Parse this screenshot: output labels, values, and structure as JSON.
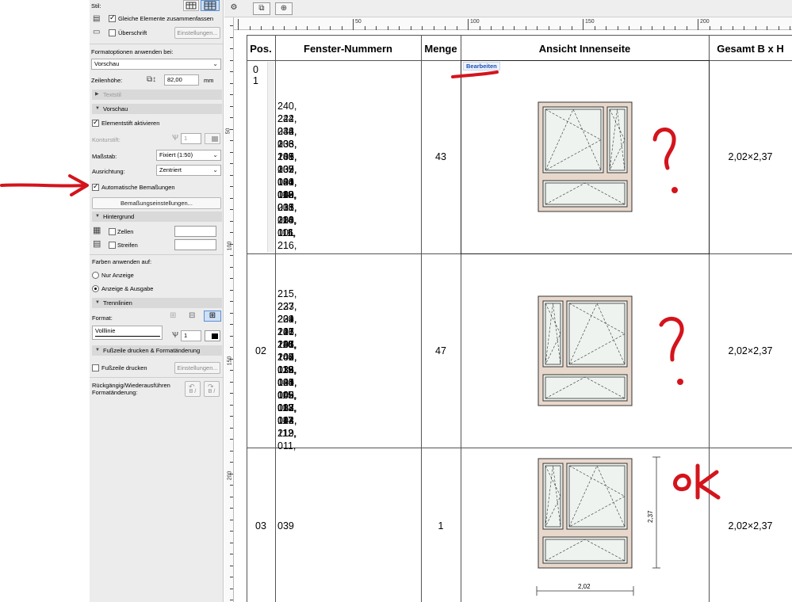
{
  "panel": {
    "stil_label": "Stil:",
    "gleiche_elemente": "Gleiche Elemente zusammenfassen",
    "ueberschrift": "Überschrift",
    "einstellungen": "Einstellungen...",
    "formatoptionen_label": "Formatoptionen anwenden bei:",
    "vorschau_select": "Vorschau",
    "zeilenhoehe_label": "Zeilenhöhe:",
    "zeilenhoehe_value": "82,00",
    "zeilenhoehe_unit": "mm",
    "textstil_section": "Textstil",
    "vorschau_section": "Vorschau",
    "elementstift": "Elementstift aktivieren",
    "konturstift_label": "Konturstift:",
    "konturstift_value": "1",
    "massstab_label": "Maßstab:",
    "massstab_value": "Fixiert (1:50)",
    "ausrichtung_label": "Ausrichtung:",
    "ausrichtung_value": "Zentriert",
    "auto_bemassungen": "Automatische Bemaßungen",
    "bemassungseinstellungen": "Bemaßungseinstellungen...",
    "hintergrund_section": "Hintergrund",
    "zellen": "Zellen",
    "streifen": "Streifen",
    "farben_label": "Farben anwenden auf:",
    "nur_anzeige": "Nur Anzeige",
    "anzeige_ausgabe": "Anzeige & Ausgabe",
    "trennlinien_section": "Trennlinien",
    "format_label": "Format:",
    "linetype": "Volllinie",
    "pen_value": "1",
    "fusszeile_section": "Fußzeile drucken & Formatänderung",
    "fusszeile_drucken": "Fußzeile drucken",
    "einstellungen2": "Einstellungen...",
    "undo_line1": "Rückgängig/Wiederausführen",
    "undo_line2": "Formatänderung:",
    "undo_btn1": "B /",
    "undo_btn2": "B /"
  },
  "rulers": {
    "top": [
      "50",
      "100",
      "150",
      "200"
    ],
    "left": [
      "50",
      "100",
      "150",
      "200"
    ]
  },
  "table": {
    "headers": [
      "Pos.",
      "Fenster-Nummern",
      "Menge",
      "Ansicht Innenseite",
      "Gesamt B x H"
    ],
    "edit_badge": "Bearbeiten",
    "rows": [
      {
        "pos_a": "0",
        "pos_b": "1",
        "nummern": [
          "240, 222, 234, 236, 238,",
          "244, 242, 203, 205, 209,",
          "036, 033, 109, 132, 134,",
          "136, 141, 139, 101, 102,",
          "105, 107, 120, 008, 031,",
          "035, 044, 040, 038, 003,",
          "006, 019, 015, 218, 116,",
          "118, 201, 220, 111, 216,",
          "013, 114, 001"
        ],
        "menge": "43",
        "gesamt": "2,02×2,37"
      },
      {
        "pos": "02",
        "nummern": [
          "215, 223, 221, 217, 235,",
          "237, 239, 243, 241, 202,",
          "204, 206, 208, 207, 016,",
          "121, 110, 108, 133, 135,",
          "137, 140, 138, 103, 106,",
          "104, 119, 020, 009, 007,",
          "032, 041, 042, 037, 002,",
          "004, 005, 018, 014, 219,",
          "115, 012, 143, 112, 011,",
          "113, 117"
        ],
        "menge": "47",
        "gesamt": "2,02×2,37"
      },
      {
        "pos": "03",
        "nummern": [
          "039"
        ],
        "menge": "1",
        "gesamt": "2,02×2,37",
        "dim_v": "2,37",
        "dim_h": "2,02"
      }
    ]
  },
  "annotations": {
    "q1": "?",
    "q2": "?",
    "ok": "ok"
  },
  "colors": {
    "panel_bg": "#ececec",
    "section_bg": "#d9d9d9",
    "frame": "#e8d8cc",
    "ink_red": "#d4141c",
    "badge_blue": "#1b4fb8"
  }
}
